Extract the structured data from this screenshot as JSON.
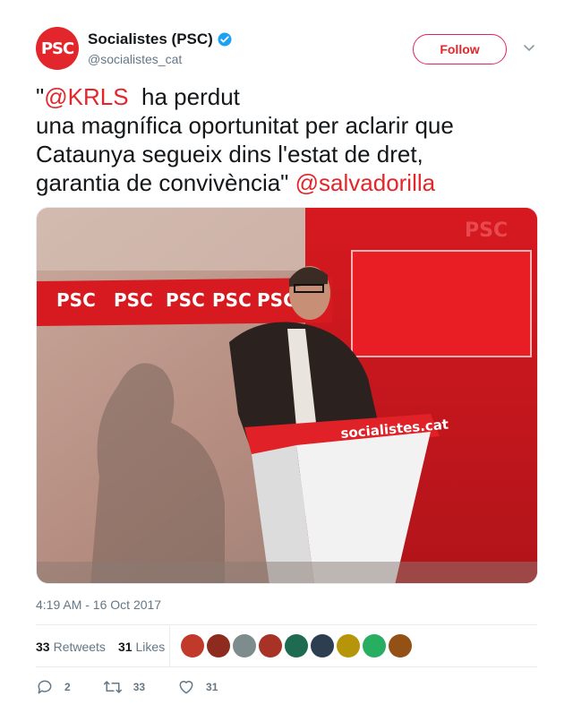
{
  "account": {
    "display_name": "Socialistes (PSC)",
    "handle": "@socialistes_cat",
    "avatar_text": "PSC",
    "brand_color": "#e3262b",
    "verified_color": "#1da1f2"
  },
  "follow_label": "Follow",
  "tweet": {
    "quote_open": "\"",
    "mention_1": "@KRLS",
    "line_1_rest": "  ha perdut",
    "line_2": "una magnífica oportunitat per aclarir que",
    "line_3": "Cataunya segueix dins l'estat de dret,",
    "line_4": "garantia de convivència\" ",
    "mention_2": "@salvadorilla"
  },
  "photo": {
    "backdrop_logo": "PSC",
    "podium_text": "socialistes.cat"
  },
  "timestamp": "4:19 AM - 16 Oct 2017",
  "stats": {
    "retweets_count": "33",
    "retweets_label": "Retweets",
    "likes_count": "31",
    "likes_label": "Likes"
  },
  "liker_colors": [
    "#c0392b",
    "#8e2b1f",
    "#7f8c8d",
    "#a93226",
    "#1e6b52",
    "#2c3e50",
    "#b7950b",
    "#27ae60",
    "#935116"
  ],
  "actions": {
    "replies": "2",
    "retweets": "33",
    "likes": "31"
  }
}
